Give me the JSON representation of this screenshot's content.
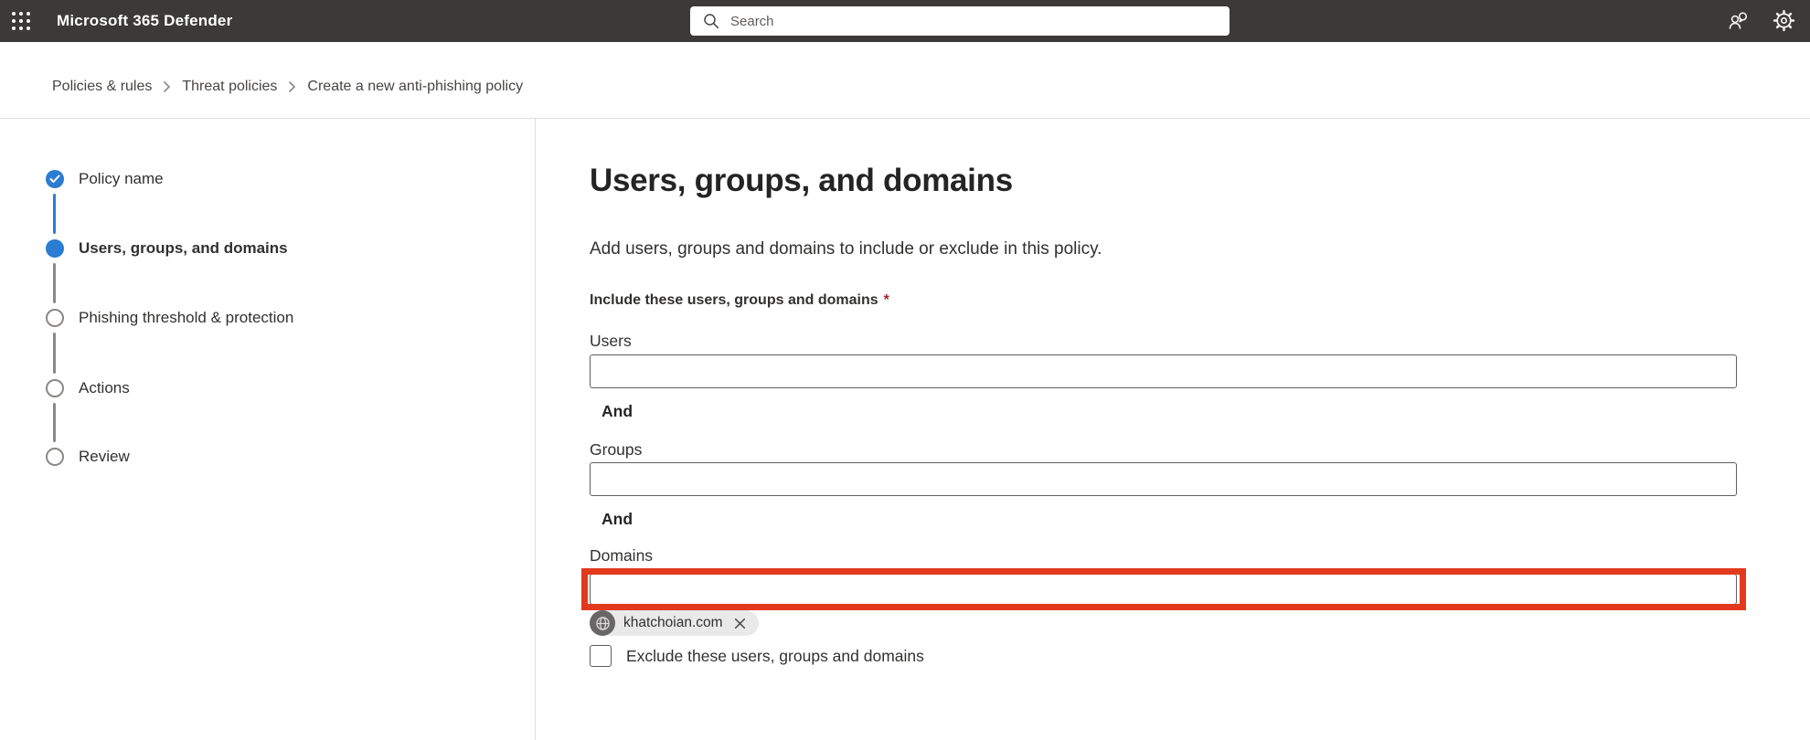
{
  "header": {
    "app_title": "Microsoft 365 Defender",
    "search": {
      "placeholder": "Search",
      "value": ""
    }
  },
  "breadcrumb": {
    "items": [
      {
        "label": "Policies & rules"
      },
      {
        "label": "Threat policies"
      },
      {
        "label": "Create a new anti-phishing policy"
      }
    ]
  },
  "wizard": {
    "steps": [
      {
        "label": "Policy name",
        "state": "completed"
      },
      {
        "label": "Users, groups, and domains",
        "state": "current"
      },
      {
        "label": "Phishing threshold & protection",
        "state": "upcoming"
      },
      {
        "label": "Actions",
        "state": "upcoming"
      },
      {
        "label": "Review",
        "state": "upcoming"
      }
    ]
  },
  "main": {
    "title": "Users, groups, and domains",
    "description": "Add users, groups and domains to include or exclude in this policy.",
    "include_section": {
      "label": "Include these users, groups and domains",
      "required_marker": "*"
    },
    "and_separator": "And",
    "fields": {
      "users": {
        "label": "Users",
        "value": ""
      },
      "groups": {
        "label": "Groups",
        "value": ""
      },
      "domains": {
        "label": "Domains",
        "value": ""
      }
    },
    "domain_chips": [
      {
        "text": "khatchoian.com"
      }
    ],
    "exclude_checkbox": {
      "label": "Exclude these users, groups and domains",
      "checked": false
    }
  },
  "icons": {
    "app_launcher": "waffle-grid",
    "search": "magnifier",
    "feedback": "person-with-speech-bubble",
    "settings": "gear",
    "step_completed": "checkmark",
    "breadcrumb_separator": "chevron-right",
    "chip_avatar": "globe",
    "chip_remove": "x-close"
  },
  "colors": {
    "header_bg": "#3b3a39",
    "accent_blue": "#2b7cd3",
    "highlight_red": "#e23a1c",
    "required_red": "#a4262c",
    "divider": "#e1dfdd",
    "input_border": "#605e5c",
    "chip_bg": "#e9e9e9",
    "chip_avatar_bg": "#696667"
  }
}
